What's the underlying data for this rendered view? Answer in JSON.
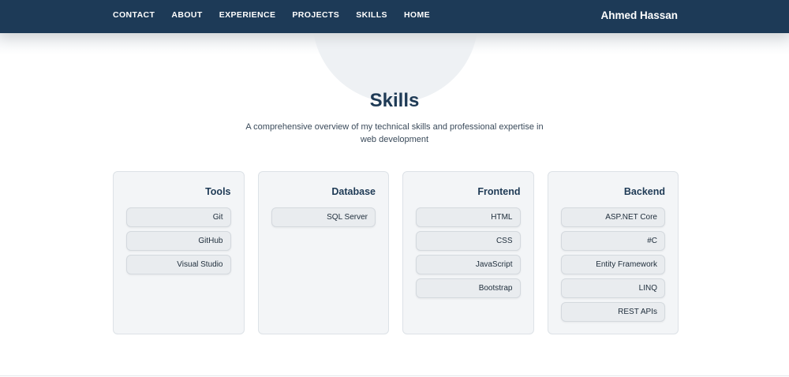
{
  "nav": {
    "links": [
      "CONTACT",
      "ABOUT",
      "EXPERIENCE",
      "PROJECTS",
      "SKILLS",
      "HOME"
    ],
    "brand": "Ahmed Hassan"
  },
  "section": {
    "title": "Skills",
    "subtitle": "A comprehensive overview of my technical skills and professional expertise in web development"
  },
  "cards": [
    {
      "title": "Tools",
      "skills": [
        "Git",
        "GitHub",
        "Visual Studio"
      ]
    },
    {
      "title": "Database",
      "skills": [
        "SQL Server"
      ]
    },
    {
      "title": "Frontend",
      "skills": [
        "HTML",
        "CSS",
        "JavaScript",
        "Bootstrap"
      ]
    },
    {
      "title": "Backend",
      "skills": [
        "ASP.NET Core",
        "#C",
        "Entity Framework",
        "LINQ",
        "REST APIs"
      ]
    }
  ],
  "colors": {
    "navbar": "#1d3a57",
    "card_bg": "#f3f5f7",
    "pill_bg": "#e9ecef"
  }
}
